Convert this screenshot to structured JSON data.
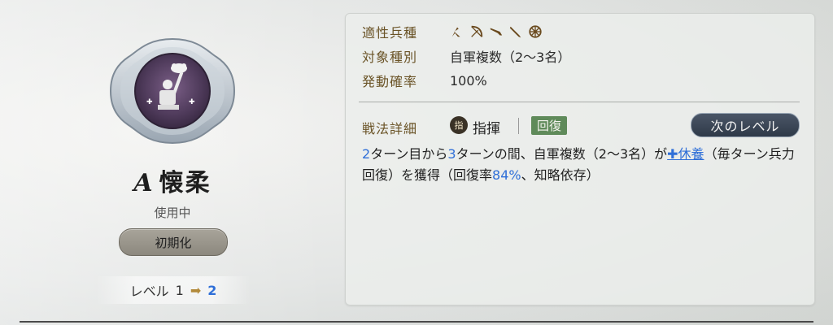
{
  "skill": {
    "grade": "A",
    "name": "懐柔",
    "status": "使用中",
    "reset_label": "初期化",
    "level_label": "レベル",
    "level_current": "1",
    "level_next": "2"
  },
  "info": {
    "aptitude_label": "適性兵種",
    "aptitude_icons": [
      "spear-icon",
      "bow-icon",
      "gun-icon",
      "sword-icon",
      "wheel-icon"
    ],
    "target_label": "対象種別",
    "target_value": "自軍複数（2〜3名）",
    "rate_label": "発動確率",
    "rate_value": "100%"
  },
  "detail": {
    "label": "戦法詳細",
    "type_icon_text": "指",
    "type_text": "指揮",
    "tag": "回復",
    "next_level_label": "次のレベル",
    "desc": {
      "n1": "2",
      "t1": "ターン目から",
      "n2": "3",
      "t2": "ターンの間、自軍複数（2〜3名）が",
      "buff": "✚休養",
      "t3": "（毎ターン兵力回復）を獲得（回復率",
      "rate": "84%",
      "t4": "、知略依存）"
    }
  },
  "colors": {
    "accent_blue": "#2f6fd8",
    "label_brown": "#6a5326",
    "tag_green": "#5f8a5a"
  }
}
